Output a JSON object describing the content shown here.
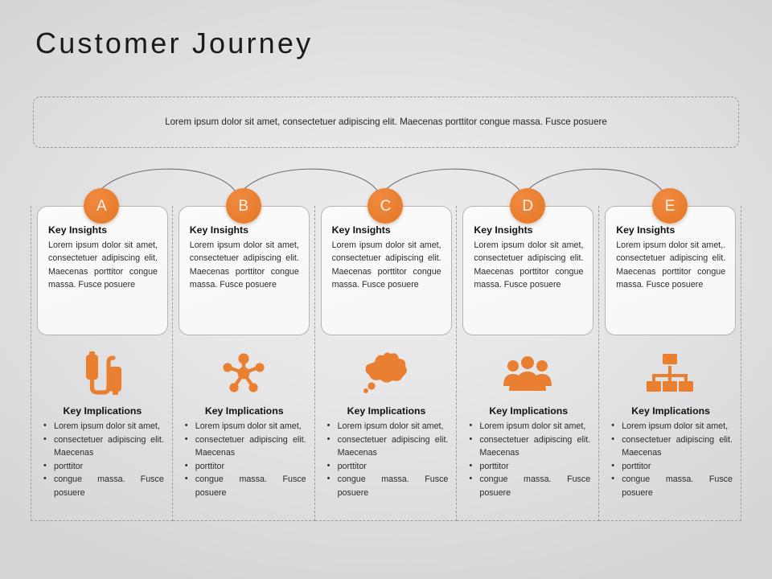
{
  "page_title": "Customer Journey",
  "intro": {
    "text": "Lorem ipsum dolor sit amet, consectetuer adipiscing elit. Maecenas porttitor congue massa. Fusce posuere"
  },
  "colors": {
    "accent_orange": "#e97f31",
    "circle_letter": "#fdf1e6",
    "text": "#2b2b2b",
    "heading": "#111111",
    "dashed_border": "#9a9a9a",
    "card_border": "#b5b5b5",
    "arrow": "#6e6e6e",
    "background_light": "#ececed",
    "background_dark": "#d6d6d8"
  },
  "stages": [
    {
      "letter": "A",
      "icon": "usb-cable-icon",
      "insights_title": "Key Insights",
      "insights_body": "Lorem ipsum dolor sit amet, consectetuer adipiscing elit. Maecenas porttitor congue massa. Fusce posuere",
      "implications_title": "Key Implications",
      "implications": [
        "Lorem ipsum dolor sit amet,",
        "consectetuer adipiscing elit. Maecenas",
        " porttitor",
        "congue massa. Fusce posuere"
      ]
    },
    {
      "letter": "B",
      "icon": "network-hub-icon",
      "insights_title": "Key Insights",
      "insights_body": "Lorem ipsum dolor sit amet, consectetuer adipiscing elit. Maecenas porttitor congue massa. Fusce posuere",
      "implications_title": "Key Implications",
      "implications": [
        "Lorem ipsum dolor sit amet,",
        "consectetuer adipiscing elit. Maecenas",
        " porttitor",
        "congue massa. Fusce posuere"
      ]
    },
    {
      "letter": "C",
      "icon": "thought-cloud-icon",
      "insights_title": "Key Insights",
      "insights_body": "Lorem ipsum dolor sit amet, consectetuer adipiscing elit. Maecenas porttitor congue massa. Fusce posuere",
      "implications_title": "Key Implications",
      "implications": [
        "Lorem ipsum dolor sit amet,",
        "consectetuer adipiscing elit. Maecenas",
        " porttitor",
        "congue massa. Fusce posuere"
      ]
    },
    {
      "letter": "D",
      "icon": "people-group-icon",
      "insights_title": "Key Insights",
      "insights_body": "Lorem ipsum dolor sit amet, consectetuer adipiscing elit. Maecenas porttitor congue massa. Fusce posuere",
      "implications_title": "Key Implications",
      "implications": [
        "Lorem ipsum dolor sit amet,",
        "consectetuer adipiscing elit. Maecenas",
        " porttitor",
        "congue massa. Fusce posuere"
      ]
    },
    {
      "letter": "E",
      "icon": "org-chart-icon",
      "insights_title": "Key Insights",
      "insights_body": "Lorem ipsum dolor sit amet,. consectetuer adipiscing elit. Maecenas porttitor congue massa. Fusce posuere",
      "implications_title": "Key Implications",
      "implications": [
        "Lorem ipsum dolor sit amet,",
        "consectetuer adipiscing elit. Maecenas",
        " porttitor",
        "congue massa. Fusce posuere"
      ]
    }
  ],
  "flow_arrows": [
    {
      "from": "A",
      "to": "B"
    },
    {
      "from": "B",
      "to": "C"
    },
    {
      "from": "C",
      "to": "D"
    },
    {
      "from": "D",
      "to": "E"
    }
  ]
}
